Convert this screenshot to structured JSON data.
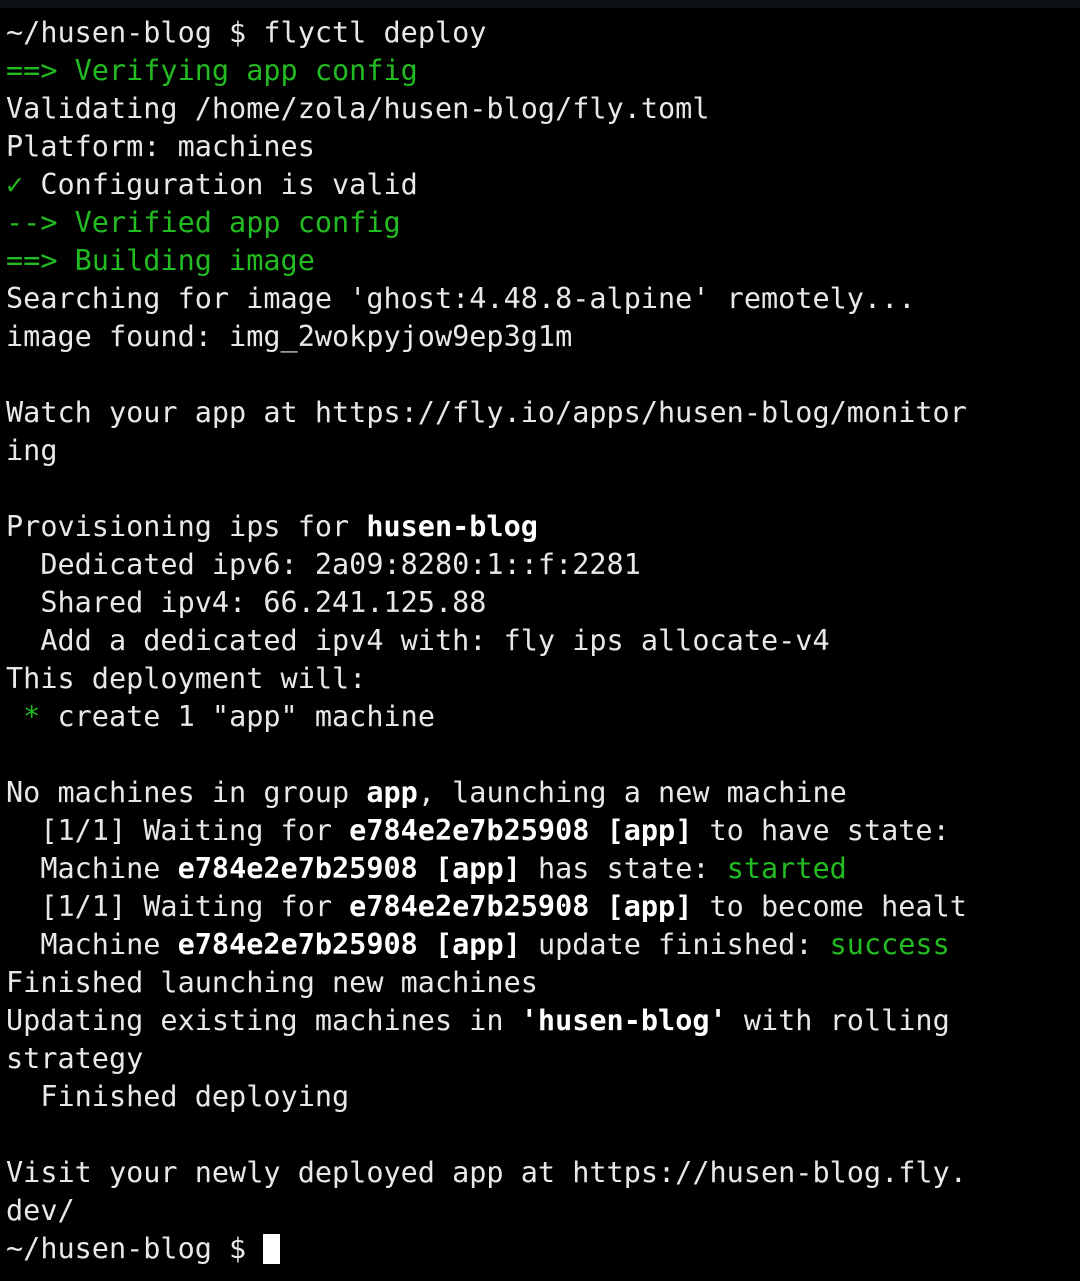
{
  "terminal": {
    "app_title": "Terminal — flyctl deploy",
    "background_color": "#000000",
    "foreground_color": "#e8e8e8",
    "accent_green": "#22bb22",
    "topbar_color": "#0d1214",
    "prompt": "~/husen-blog $ ",
    "command": "flyctl deploy",
    "cursor_visible": true,
    "lines": [
      {
        "id": "l01",
        "segments": [
          {
            "text": "~/husen-blog $ ",
            "style": "white"
          },
          {
            "text": "flyctl deploy",
            "style": "white"
          }
        ]
      },
      {
        "id": "l02",
        "segments": [
          {
            "text": "==> Verifying app config",
            "style": "green"
          }
        ]
      },
      {
        "id": "l03",
        "segments": [
          {
            "text": "Validating /home/zola/husen-blog/fly.toml",
            "style": "white"
          }
        ]
      },
      {
        "id": "l04",
        "segments": [
          {
            "text": "Platform: machines",
            "style": "white"
          }
        ]
      },
      {
        "id": "l05",
        "segments": [
          {
            "text": "✓",
            "style": "green"
          },
          {
            "text": " Configuration is valid",
            "style": "white"
          }
        ]
      },
      {
        "id": "l06",
        "segments": [
          {
            "text": "--> Verified app config",
            "style": "green"
          }
        ]
      },
      {
        "id": "l07",
        "segments": [
          {
            "text": "==> Building image",
            "style": "green"
          }
        ]
      },
      {
        "id": "l08",
        "segments": [
          {
            "text": "Searching for image 'ghost:4.48.8-alpine' remotely...",
            "style": "white"
          }
        ]
      },
      {
        "id": "l09",
        "segments": [
          {
            "text": "image found: img_2wokpyjow9ep3g1m",
            "style": "white"
          }
        ]
      },
      {
        "id": "l10",
        "segments": []
      },
      {
        "id": "l11",
        "segments": [
          {
            "text": "Watch your app at https://fly.io/apps/husen-blog/monitor",
            "style": "white"
          }
        ]
      },
      {
        "id": "l12",
        "segments": [
          {
            "text": "ing",
            "style": "white"
          }
        ]
      },
      {
        "id": "l13",
        "segments": []
      },
      {
        "id": "l14",
        "segments": [
          {
            "text": "Provisioning ips for ",
            "style": "white"
          },
          {
            "text": "husen-blog",
            "style": "bold"
          }
        ]
      },
      {
        "id": "l15",
        "segments": [
          {
            "text": "  Dedicated ipv6: 2a09:8280:1::f:2281",
            "style": "white"
          }
        ]
      },
      {
        "id": "l16",
        "segments": [
          {
            "text": "  Shared ipv4: 66.241.125.88",
            "style": "white"
          }
        ]
      },
      {
        "id": "l17",
        "segments": [
          {
            "text": "  Add a dedicated ipv4 with: fly ips allocate-v4",
            "style": "white"
          }
        ]
      },
      {
        "id": "l18",
        "segments": [
          {
            "text": "This deployment will:",
            "style": "white"
          }
        ]
      },
      {
        "id": "l19",
        "segments": [
          {
            "text": " *",
            "style": "green"
          },
          {
            "text": " create 1 \"app\" machine",
            "style": "white"
          }
        ]
      },
      {
        "id": "l20",
        "segments": []
      },
      {
        "id": "l21",
        "segments": [
          {
            "text": "No machines in group ",
            "style": "white"
          },
          {
            "text": "app",
            "style": "bold"
          },
          {
            "text": ", launching a new machine",
            "style": "white"
          }
        ]
      },
      {
        "id": "l22",
        "segments": [
          {
            "text": "  [1/1] Waiting for ",
            "style": "white"
          },
          {
            "text": "e784e2e7b25908",
            "style": "bold"
          },
          {
            "text": " ",
            "style": "white"
          },
          {
            "text": "[app]",
            "style": "bold"
          },
          {
            "text": " to have state:",
            "style": "white"
          }
        ]
      },
      {
        "id": "l23",
        "segments": [
          {
            "text": "  Machine ",
            "style": "white"
          },
          {
            "text": "e784e2e7b25908",
            "style": "bold"
          },
          {
            "text": " ",
            "style": "white"
          },
          {
            "text": "[app]",
            "style": "bold"
          },
          {
            "text": " has state: ",
            "style": "white"
          },
          {
            "text": "started",
            "style": "green"
          }
        ]
      },
      {
        "id": "l24",
        "segments": [
          {
            "text": "  [1/1] Waiting for ",
            "style": "white"
          },
          {
            "text": "e784e2e7b25908",
            "style": "bold"
          },
          {
            "text": " ",
            "style": "white"
          },
          {
            "text": "[app]",
            "style": "bold"
          },
          {
            "text": " to become healt",
            "style": "white"
          }
        ]
      },
      {
        "id": "l25",
        "segments": [
          {
            "text": "  Machine ",
            "style": "white"
          },
          {
            "text": "e784e2e7b25908",
            "style": "bold"
          },
          {
            "text": " ",
            "style": "white"
          },
          {
            "text": "[app]",
            "style": "bold"
          },
          {
            "text": " update finished: ",
            "style": "white"
          },
          {
            "text": "success",
            "style": "green"
          }
        ]
      },
      {
        "id": "l26",
        "segments": [
          {
            "text": "Finished launching new machines",
            "style": "white"
          }
        ]
      },
      {
        "id": "l27",
        "segments": [
          {
            "text": "Updating existing machines in ",
            "style": "white"
          },
          {
            "text": "'husen-blog'",
            "style": "bold"
          },
          {
            "text": " with rolling",
            "style": "white"
          }
        ]
      },
      {
        "id": "l28",
        "segments": [
          {
            "text": "strategy",
            "style": "white"
          }
        ]
      },
      {
        "id": "l29",
        "segments": [
          {
            "text": "  Finished deploying",
            "style": "white"
          }
        ]
      },
      {
        "id": "l30",
        "segments": []
      },
      {
        "id": "l31",
        "segments": [
          {
            "text": "Visit your newly deployed app at https://husen-blog.fly.",
            "style": "white"
          }
        ]
      },
      {
        "id": "l32",
        "segments": [
          {
            "text": "dev/",
            "style": "white"
          }
        ]
      },
      {
        "id": "l33",
        "segments": [
          {
            "text": "~/husen-blog $ ",
            "style": "white"
          }
        ],
        "cursor": true
      }
    ]
  }
}
